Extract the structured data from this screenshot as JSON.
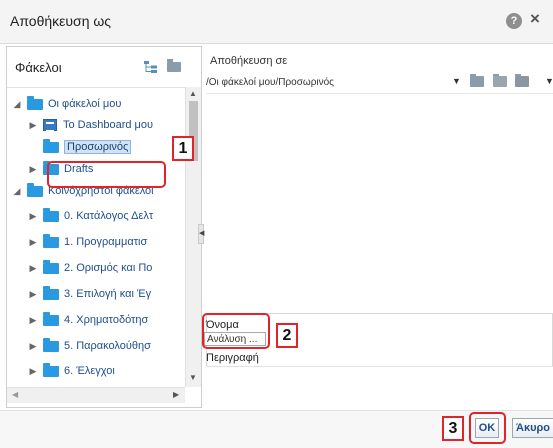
{
  "dialog": {
    "title": "Αποθήκευση ως"
  },
  "left_panel": {
    "title": "Φάκελοι",
    "tree": [
      {
        "label": "Οι φάκελοί μου",
        "expanded": true
      },
      {
        "label": "To Dashboard μου",
        "icon": "dashboard-icon"
      },
      {
        "label": "Προσωρινός",
        "selected": true
      },
      {
        "label": "Drafts"
      },
      {
        "label": "Κοινόχρηστοι φάκελοι",
        "expanded": true
      },
      {
        "label": "0. Κατάλογος Δελτ"
      },
      {
        "label": "1.  Προγραμματισ"
      },
      {
        "label": "2. Ορισμός και Πο"
      },
      {
        "label": "3. Επιλογή και Έγ"
      },
      {
        "label": "4. Χρηματοδότησ"
      },
      {
        "label": "5. Παρακολούθησ"
      },
      {
        "label": "6. Έλεγχοι"
      }
    ]
  },
  "right_panel": {
    "save_in_label": "Αποθήκευση σε",
    "path_value": "/Οι φάκελοί μου/Προσωρινός",
    "name_label": "Όνομα",
    "name_value": "Ανάλυση ...",
    "description_label": "Περιγραφή"
  },
  "footer": {
    "ok_label": "OK",
    "cancel_label": "Άκυρο"
  },
  "callouts": [
    "1",
    "2",
    "3"
  ],
  "colors": {
    "accent_folder": "#2a9ae0",
    "callout_red": "#e0242a",
    "link_blue": "#1f4e8c"
  }
}
